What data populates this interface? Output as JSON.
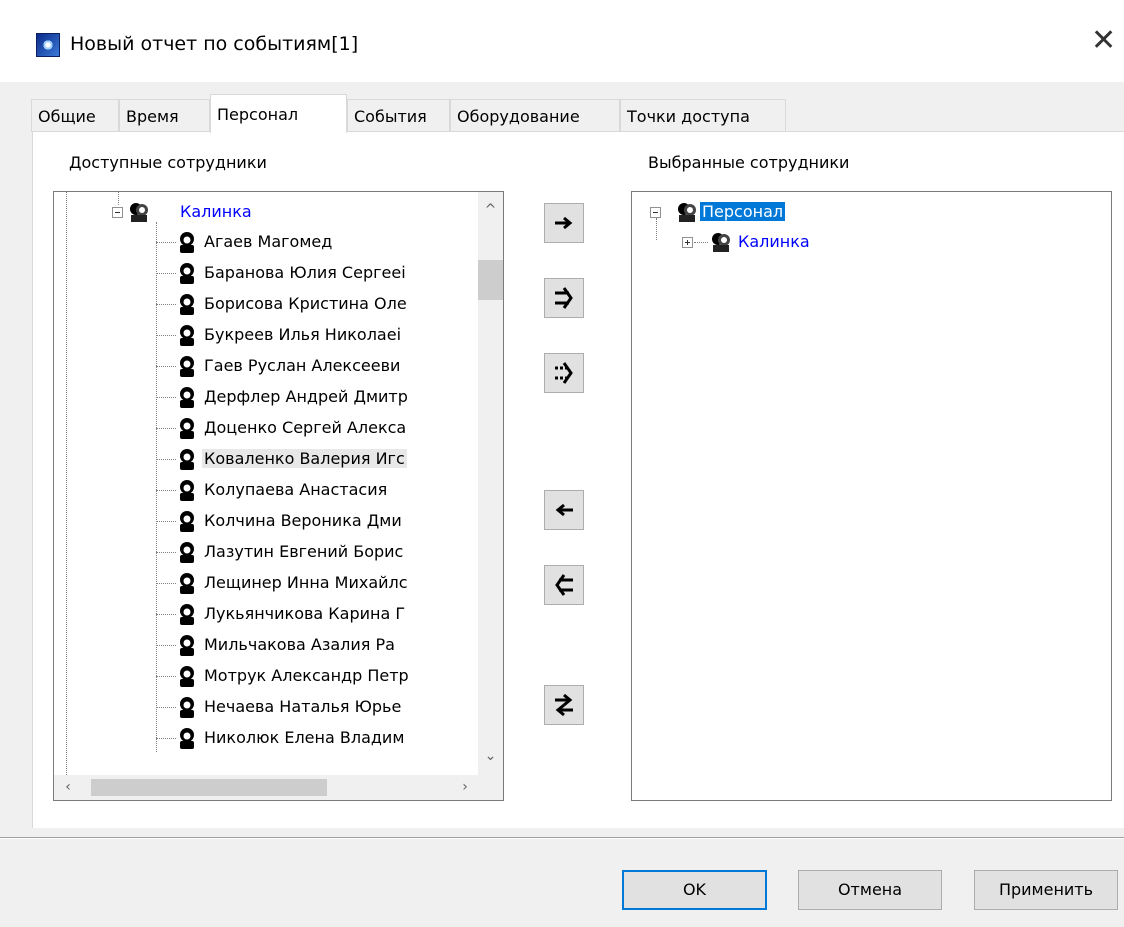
{
  "window": {
    "title": "Новый отчет по событиям[1]",
    "close_glyph": "✕",
    "icon": "app-globe-icon"
  },
  "tabs": [
    {
      "label": "Общие"
    },
    {
      "label": "Время"
    },
    {
      "label": "Персонал",
      "active": true
    },
    {
      "label": "События"
    },
    {
      "label": "Оборудование"
    },
    {
      "label": "Точки доступа"
    }
  ],
  "available": {
    "label": "Доступные сотрудники",
    "group": {
      "label": "Калинка",
      "expanded": true,
      "icon": "group-icon"
    },
    "employees": [
      "Агаев Магомед",
      "Баранова Юлия Сергееі",
      "Борисова Кристина Оле",
      "Букреев Илья Николаеі",
      "Гаев Руслан Алексееви",
      "Дерфлер Андрей Дмитр",
      "Доценко Сергей Алекса",
      "Коваленко Валерия Игс",
      "Колупаева Анастасия",
      "Колчина Вероника Дми",
      "Лазутин Евгений Борис",
      "Лещинер Инна Михайлс",
      "Лукьянчикова Карина Г",
      "Мильчакова Азалия Ра",
      "Мотрук Александр Петр",
      "Нечаева Наталья Юрье",
      "Николюк Елена Владим"
    ],
    "hovered_index": 7
  },
  "selected": {
    "label": "Выбранные сотрудники",
    "root": {
      "label": "Персонал",
      "selected": true
    },
    "child": {
      "label": "Калинка",
      "expanded": false
    }
  },
  "move_buttons": [
    {
      "name": "move-right-button",
      "icon": "arrow-right-icon"
    },
    {
      "name": "move-all-right-button",
      "icon": "double-arrow-right-icon"
    },
    {
      "name": "move-all-children-right-button",
      "icon": "dotted-double-arrow-right-icon"
    },
    {
      "name": "move-left-button",
      "icon": "arrow-left-icon"
    },
    {
      "name": "move-all-left-button",
      "icon": "double-arrow-left-icon"
    },
    {
      "name": "swap-button",
      "icon": "swap-arrows-icon"
    }
  ],
  "buttons": {
    "ok": "OK",
    "cancel": "Отмена",
    "apply": "Применить"
  },
  "colors": {
    "selection": "#0078d7",
    "link_text": "#0000ff",
    "hover": "#e8e8e8"
  }
}
